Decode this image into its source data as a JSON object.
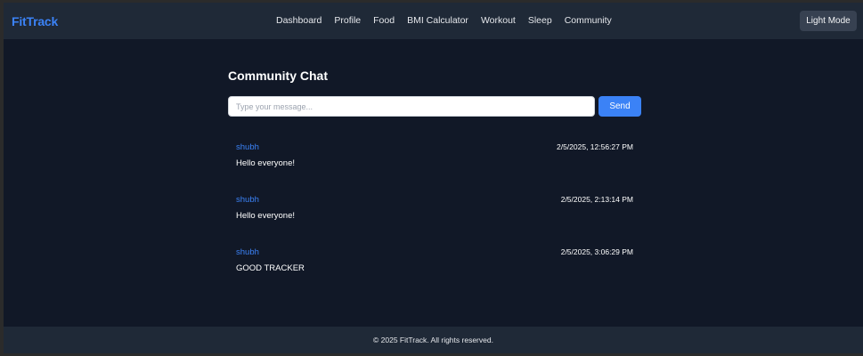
{
  "header": {
    "brand": "FitTrack",
    "nav": [
      "Dashboard",
      "Profile",
      "Food",
      "BMI Calculator",
      "Workout",
      "Sleep",
      "Community"
    ],
    "theme_toggle": "Light Mode"
  },
  "chat": {
    "title": "Community Chat",
    "input_placeholder": "Type your message...",
    "send_label": "Send",
    "messages": [
      {
        "user": "shubh",
        "time": "2/5/2025, 12:56:27 PM",
        "text": "Hello everyone!"
      },
      {
        "user": "shubh",
        "time": "2/5/2025, 2:13:14 PM",
        "text": "Hello everyone!"
      },
      {
        "user": "shubh",
        "time": "2/5/2025, 3:06:29 PM",
        "text": "GOOD TRACKER"
      }
    ]
  },
  "footer": {
    "text": "© 2025 FitTrack. All rights reserved."
  },
  "colors": {
    "background": "#111827",
    "surface": "#1f2937",
    "accent": "#3b82f6",
    "button_dark": "#374151",
    "text": "#ffffff"
  }
}
